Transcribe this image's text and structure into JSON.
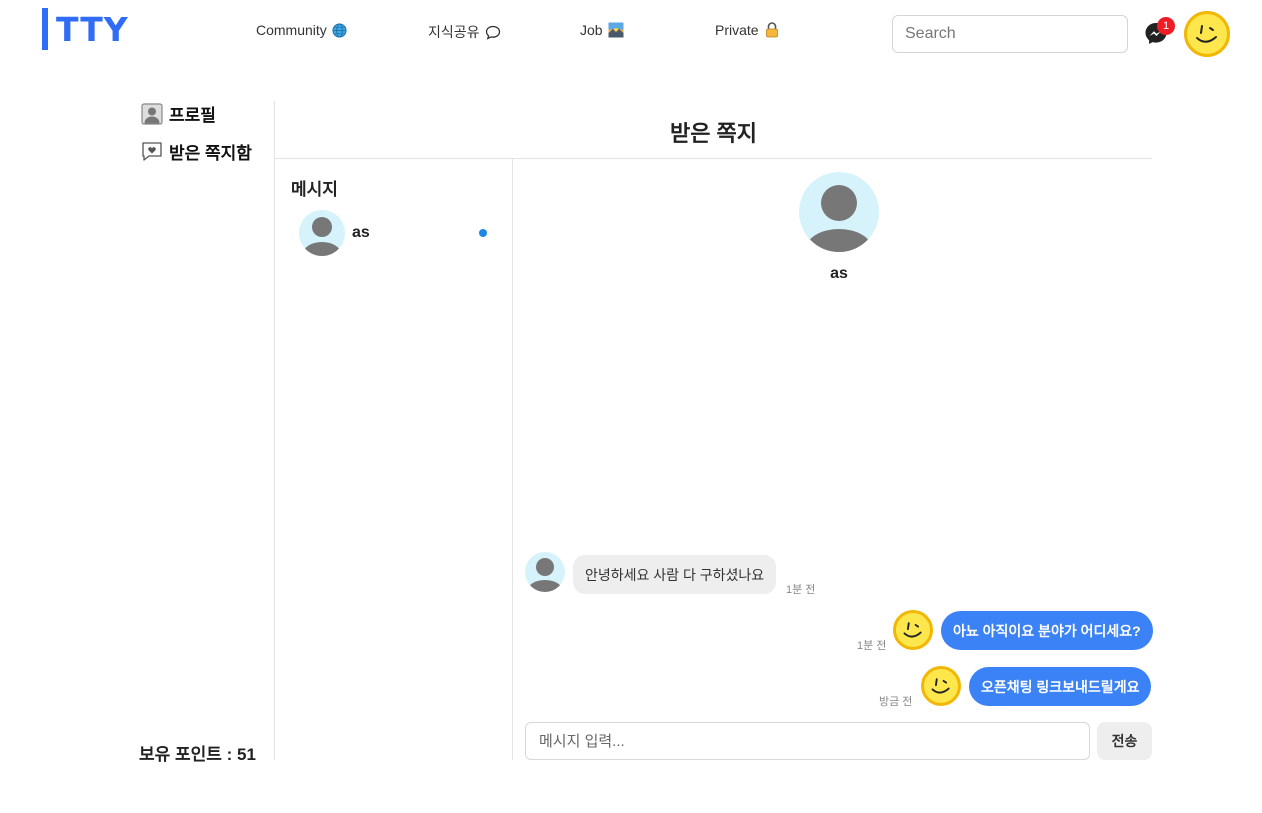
{
  "header": {
    "logo": "TTY",
    "nav": [
      {
        "label": "Community",
        "icon": "globe-icon"
      },
      {
        "label": "지식공유",
        "icon": "speech-bubble-icon"
      },
      {
        "label": "Job",
        "icon": "sunrise-icon"
      },
      {
        "label": "Private",
        "icon": "lock-icon"
      }
    ],
    "search_placeholder": "Search",
    "message_badge": "1"
  },
  "sidebar": {
    "items": [
      {
        "label": "프로필",
        "icon": "profile-icon"
      },
      {
        "label": "받은 쪽지함",
        "icon": "heart-message-icon"
      }
    ],
    "points": "보유 포인트 : 51"
  },
  "main": {
    "title": "받은 쪽지",
    "list_title": "메시지",
    "conversations": [
      {
        "name": "as",
        "unread": true
      }
    ],
    "chat": {
      "partner_name": "as",
      "messages": [
        {
          "direction": "in",
          "text": "안녕하세요 사람 다 구하셨나요",
          "time": "1분 전"
        },
        {
          "direction": "out",
          "text": "아뇨 아직이요 분야가 어디세요?",
          "time": "1분 전"
        },
        {
          "direction": "out",
          "text": "오픈채팅 링크보내드릴게요",
          "time": "방금 전"
        }
      ],
      "input_placeholder": "메시지 입력...",
      "send_label": "전송"
    }
  },
  "colors": {
    "brand": "#2f6df6",
    "bubble_out": "#3b82f6",
    "bubble_in": "#eeeeee",
    "badge": "#ee1c25",
    "unread_dot": "#1e88e5"
  }
}
